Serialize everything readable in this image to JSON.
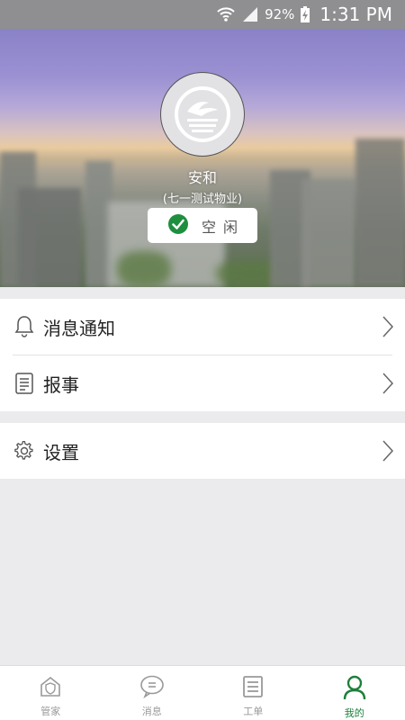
{
  "status_bar": {
    "battery": "92%",
    "time": "1:31 PM",
    "icons": [
      "wifi-icon",
      "signal-icon",
      "battery-charging-icon"
    ]
  },
  "profile": {
    "name": "安和",
    "org": "(七一测试物业)",
    "status_label": "空闲",
    "status_icon": "check-circle-icon"
  },
  "menu": {
    "notifications": {
      "label": "消息通知",
      "icon": "bell-icon"
    },
    "report": {
      "label": "报事",
      "icon": "document-icon"
    },
    "settings": {
      "label": "设置",
      "icon": "gear-icon"
    }
  },
  "bottom_nav": {
    "items": [
      {
        "label": "管家",
        "icon": "house-shield-icon",
        "active": false
      },
      {
        "label": "消息",
        "icon": "chat-bubble-icon",
        "active": false
      },
      {
        "label": "工单",
        "icon": "work-order-icon",
        "active": false
      },
      {
        "label": "我的",
        "icon": "person-icon",
        "active": true
      }
    ]
  },
  "colors": {
    "accent": "#1e7f3b",
    "inactive": "#999999",
    "background": "#ebeaed"
  }
}
